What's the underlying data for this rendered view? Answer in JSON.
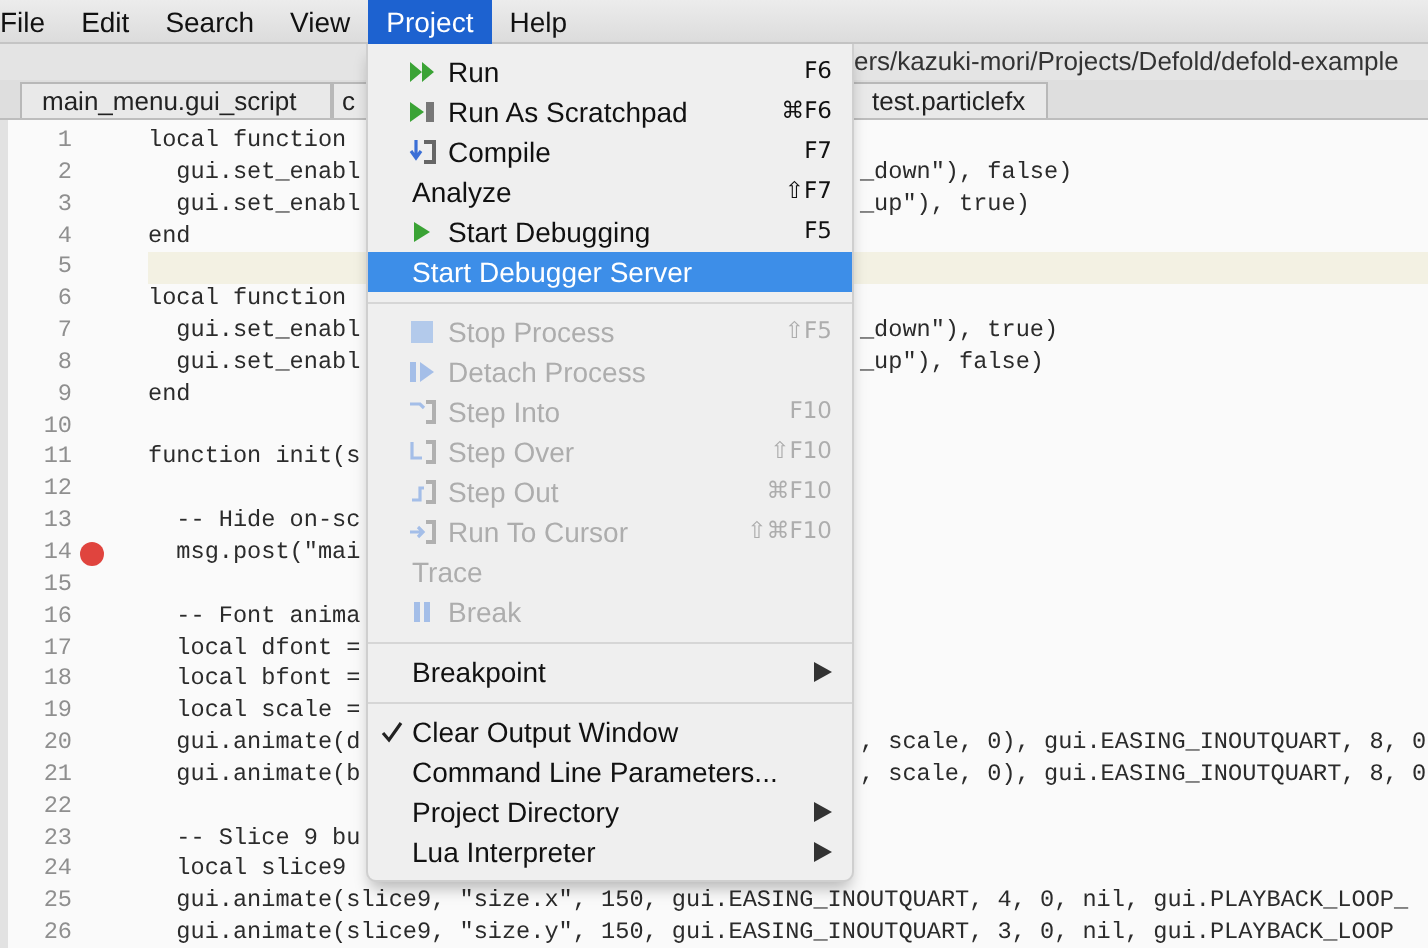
{
  "menu_bar": [
    {
      "label": "File",
      "selected": false
    },
    {
      "label": "Edit",
      "selected": false
    },
    {
      "label": "Search",
      "selected": false
    },
    {
      "label": "View",
      "selected": false
    },
    {
      "label": "Project",
      "selected": true
    },
    {
      "label": "Help",
      "selected": false
    }
  ],
  "toolbar": {
    "path": "ers/kazuki-mori/Projects/Defold/defold-example"
  },
  "tabs": [
    {
      "label": "main_menu.gui_script",
      "selected": false
    },
    {
      "label": "c",
      "selected": false
    },
    {
      "label": "test.particlefx",
      "selected": false
    }
  ],
  "editor": {
    "lines": [
      {
        "number": "1",
        "left": "local function",
        "breakpoint": false,
        "current": false
      },
      {
        "number": "2",
        "left": "  gui.set_enabl",
        "right": "_down\"), false)",
        "breakpoint": false,
        "current": false
      },
      {
        "number": "3",
        "left": "  gui.set_enabl",
        "right": "_up\"), true)",
        "breakpoint": false,
        "current": false
      },
      {
        "number": "4",
        "left": "end",
        "breakpoint": false,
        "current": false
      },
      {
        "number": "5",
        "breakpoint": false,
        "current": true
      },
      {
        "number": "6",
        "left": "local function",
        "breakpoint": false,
        "current": false
      },
      {
        "number": "7",
        "left": "  gui.set_enabl",
        "right": "_down\"), true)",
        "breakpoint": false,
        "current": false
      },
      {
        "number": "8",
        "left": "  gui.set_enabl",
        "right": "_up\"), false)",
        "breakpoint": false,
        "current": false
      },
      {
        "number": "9",
        "left": "end",
        "breakpoint": false,
        "current": false
      },
      {
        "number": "10",
        "breakpoint": false,
        "current": false
      },
      {
        "number": "11",
        "left": "function init(s",
        "breakpoint": false,
        "current": false
      },
      {
        "number": "12",
        "breakpoint": false,
        "current": false
      },
      {
        "number": "13",
        "left": "  -- Hide on-sc",
        "breakpoint": false,
        "current": false
      },
      {
        "number": "14",
        "left": "  msg.post(\"mai",
        "breakpoint": true,
        "current": false
      },
      {
        "number": "15",
        "breakpoint": false,
        "current": false
      },
      {
        "number": "16",
        "left": "  -- Font anima",
        "breakpoint": false,
        "current": false
      },
      {
        "number": "17",
        "left": "  local dfont =",
        "breakpoint": false,
        "current": false
      },
      {
        "number": "18",
        "left": "  local bfont =",
        "breakpoint": false,
        "current": false
      },
      {
        "number": "19",
        "left": "  local scale =",
        "breakpoint": false,
        "current": false
      },
      {
        "number": "20",
        "left": "  gui.animate(d",
        "right": ", scale, 0), gui.EASING_INOUTQUART, 8, 0",
        "breakpoint": false,
        "current": false
      },
      {
        "number": "21",
        "left": "  gui.animate(b",
        "right": ", scale, 0), gui.EASING_INOUTQUART, 8, 0",
        "breakpoint": false,
        "current": false
      },
      {
        "number": "22",
        "breakpoint": false,
        "current": false
      },
      {
        "number": "23",
        "left": "  -- Slice 9 bu",
        "breakpoint": false,
        "current": false
      },
      {
        "number": "24",
        "left": "  local slice9",
        "breakpoint": false,
        "current": false
      },
      {
        "number": "25",
        "left": "  gui.animate(slice9, \"size.x\", 150, gui.EASING_INOUTQUART, 4, 0, nil, gui.PLAYBACK_LOOP_",
        "breakpoint": false,
        "current": false
      },
      {
        "number": "26",
        "left": "  gui.animate(slice9, \"size.y\", 150, gui.EASING_INOUTQUART, 3, 0, nil, gui.PLAYBACK_LOOP",
        "breakpoint": false,
        "current": false
      }
    ]
  },
  "project_menu": {
    "items": [
      {
        "kind": "item",
        "label": "Run",
        "shortcut": "F6",
        "disabled": false,
        "selected": false
      },
      {
        "kind": "item",
        "label": "Run As Scratchpad",
        "shortcut": "⌘F6",
        "disabled": false,
        "selected": false
      },
      {
        "kind": "item",
        "label": "Compile",
        "shortcut": "F7",
        "disabled": false,
        "selected": false
      },
      {
        "kind": "item",
        "label": "Analyze",
        "shortcut": "⇧F7",
        "disabled": false,
        "selected": false
      },
      {
        "kind": "item",
        "label": "Start Debugging",
        "shortcut": "F5",
        "disabled": false,
        "selected": false
      },
      {
        "kind": "item",
        "label": "Start Debugger Server",
        "disabled": false,
        "selected": true
      },
      {
        "kind": "separator"
      },
      {
        "kind": "item",
        "label": "Stop Process",
        "shortcut": "⇧F5",
        "disabled": true,
        "selected": false
      },
      {
        "kind": "item",
        "label": "Detach Process",
        "disabled": true,
        "selected": false
      },
      {
        "kind": "item",
        "label": "Step Into",
        "shortcut": "F10",
        "disabled": true,
        "selected": false
      },
      {
        "kind": "item",
        "label": "Step Over",
        "shortcut": "⇧F10",
        "disabled": true,
        "selected": false
      },
      {
        "kind": "item",
        "label": "Step Out",
        "shortcut": "⌘F10",
        "disabled": true,
        "selected": false
      },
      {
        "kind": "item",
        "label": "Run To Cursor",
        "shortcut": "⇧⌘F10",
        "disabled": true,
        "selected": false
      },
      {
        "kind": "item",
        "label": "Trace",
        "disabled": true,
        "selected": false
      },
      {
        "kind": "item",
        "label": "Break",
        "disabled": true,
        "selected": false
      },
      {
        "kind": "separator"
      },
      {
        "kind": "submenu",
        "label": "Breakpoint",
        "disabled": false,
        "selected": false
      },
      {
        "kind": "separator"
      },
      {
        "kind": "check",
        "label": "Clear Output Window",
        "checked": true,
        "disabled": false,
        "selected": false
      },
      {
        "kind": "item",
        "label": "Command Line Parameters...",
        "disabled": false,
        "selected": false
      },
      {
        "kind": "submenu",
        "label": "Project Directory",
        "disabled": false,
        "selected": false
      },
      {
        "kind": "submenu",
        "label": "Lua Interpreter",
        "disabled": false,
        "selected": false
      }
    ]
  }
}
